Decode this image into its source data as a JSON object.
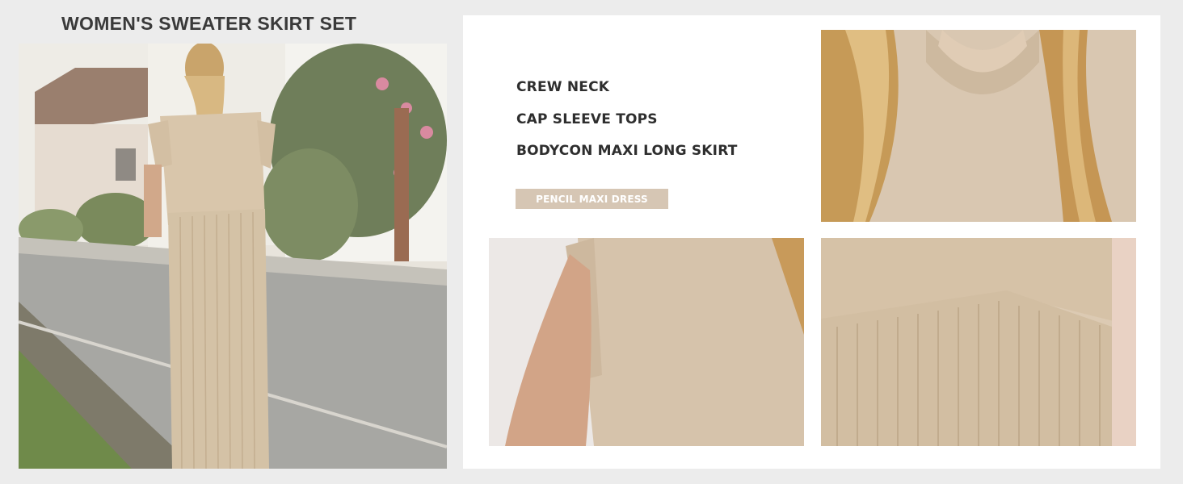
{
  "title": "WOMEN'S SWEATER SKIRT SET",
  "features": [
    "CREW NECK",
    "CAP SLEEVE TOPS",
    "BODYCON MAXI LONG SKIRT"
  ],
  "badge": "PENCIL MAXI DRESS",
  "images": {
    "main": "woman wearing beige knit top and ribbed maxi skirt on a street",
    "neck": "close-up of crew neck with blonde hair",
    "sleeve": "close-up of cap sleeve on arm",
    "skirt": "close-up of ribbed skirt waist"
  },
  "colors": {
    "beige": "#d9c7b0",
    "badge": "#d6c6b4",
    "background": "#ececec"
  }
}
